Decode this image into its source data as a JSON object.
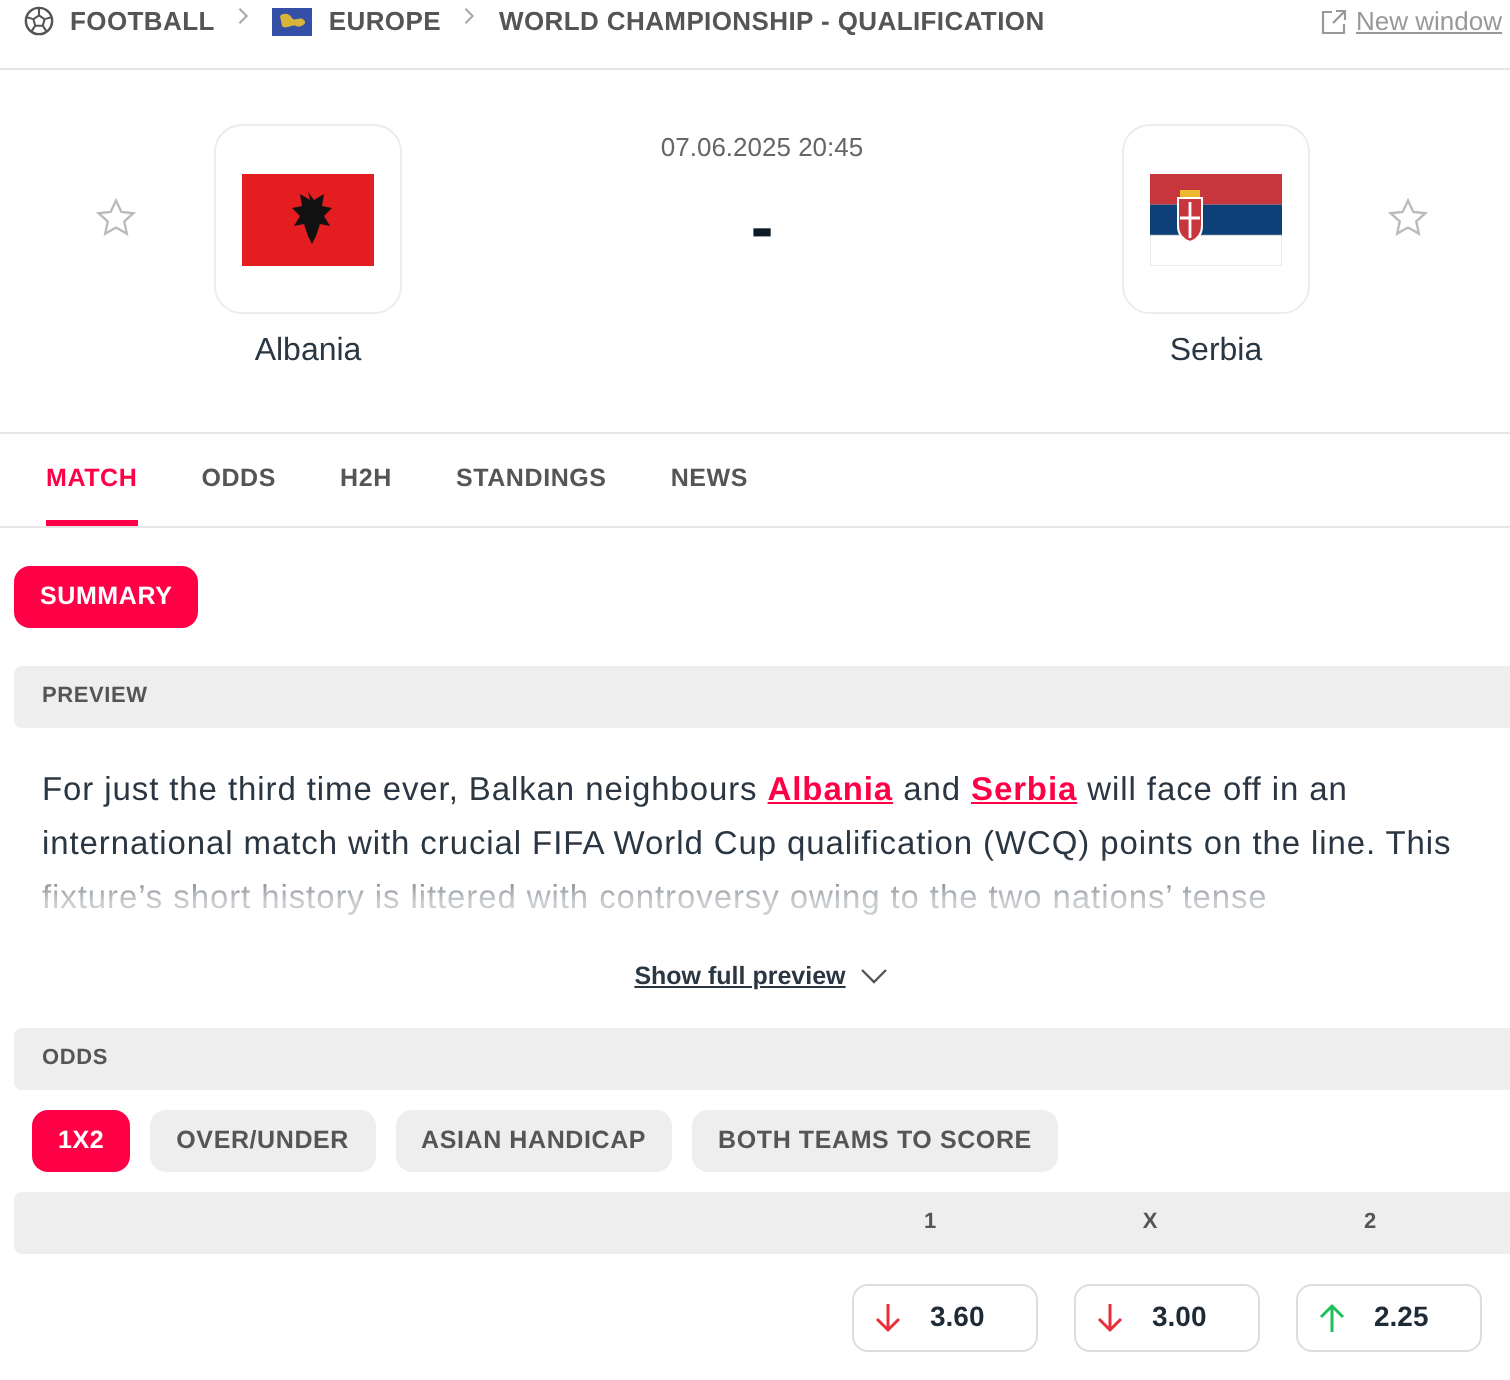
{
  "breadcrumb": [
    {
      "label": "FOOTBALL",
      "kind": "sport"
    },
    {
      "label": "EUROPE",
      "kind": "region"
    },
    {
      "label": "WORLD CHAMPIONSHIP - QUALIFICATION",
      "kind": "league"
    }
  ],
  "new_window": "New window",
  "match": {
    "datetime": "07.06.2025 20:45",
    "score": "-",
    "home": {
      "name": "Albania",
      "kind": "albania",
      "favorite": false
    },
    "away": {
      "name": "Serbia",
      "kind": "serbia",
      "favorite": false
    }
  },
  "tabs": [
    {
      "label": "MATCH",
      "selected": true
    },
    {
      "label": "ODDS",
      "selected": false
    },
    {
      "label": "H2H",
      "selected": false
    },
    {
      "label": "STANDINGS",
      "selected": false
    },
    {
      "label": "NEWS",
      "selected": false
    }
  ],
  "subtabs": [
    {
      "label": "SUMMARY",
      "selected": true
    }
  ],
  "preview": {
    "title": "PREVIEW",
    "parts": [
      {
        "kind": "text",
        "text": "For just the third time ever, Balkan neighbours "
      },
      {
        "kind": "link",
        "text": "Albania"
      },
      {
        "kind": "text",
        "text": " and "
      },
      {
        "kind": "link",
        "text": "Serbia"
      },
      {
        "kind": "text",
        "text": " will face off in an international match with crucial FIFA World Cup qualification (WCQ) points on the line. This fixture’s short history is littered with controversy owing to the two nations’ tense"
      }
    ],
    "more": "Show full preview"
  },
  "odds": {
    "title": "ODDS",
    "markets": [
      {
        "label": "1X2",
        "selected": true
      },
      {
        "label": "OVER/UNDER",
        "selected": false
      },
      {
        "label": "ASIAN HANDICAP",
        "selected": false
      },
      {
        "label": "BOTH TEAMS TO SCORE",
        "selected": false
      }
    ],
    "columns": [
      "1",
      "X",
      "2"
    ],
    "values": [
      {
        "value": "3.60",
        "kind": "down"
      },
      {
        "value": "3.00",
        "kind": "down"
      },
      {
        "value": "2.25",
        "kind": "up"
      }
    ]
  }
}
